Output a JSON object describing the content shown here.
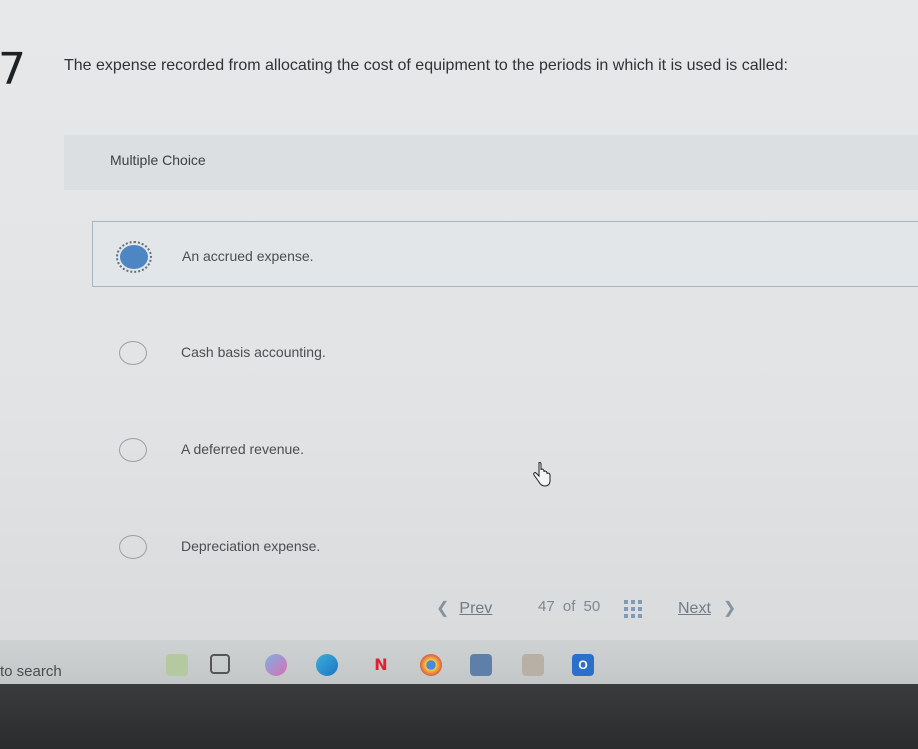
{
  "question": {
    "number": "7",
    "text": "The expense recorded from allocating the cost of equipment to the periods in which it is used is called:"
  },
  "question_type": "Multiple Choice",
  "options": [
    {
      "label": "An accrued expense.",
      "selected": true
    },
    {
      "label": "Cash basis accounting.",
      "selected": false
    },
    {
      "label": "A deferred revenue.",
      "selected": false
    },
    {
      "label": "Depreciation expense.",
      "selected": false
    }
  ],
  "navigation": {
    "prev_label": "Prev",
    "current_page": "47",
    "of_text": "of",
    "total_pages": "50",
    "next_label": "Next"
  },
  "taskbar": {
    "search_text": "to search",
    "icons": [
      "widgets-icon",
      "task-view-icon",
      "copilot-icon",
      "edge-icon",
      "news-icon",
      "chrome-icon",
      "store-icon",
      "photos-icon",
      "outlook-icon"
    ]
  },
  "colors": {
    "selected_radio": "#4e86c4",
    "accent": "#5b7fa6"
  }
}
